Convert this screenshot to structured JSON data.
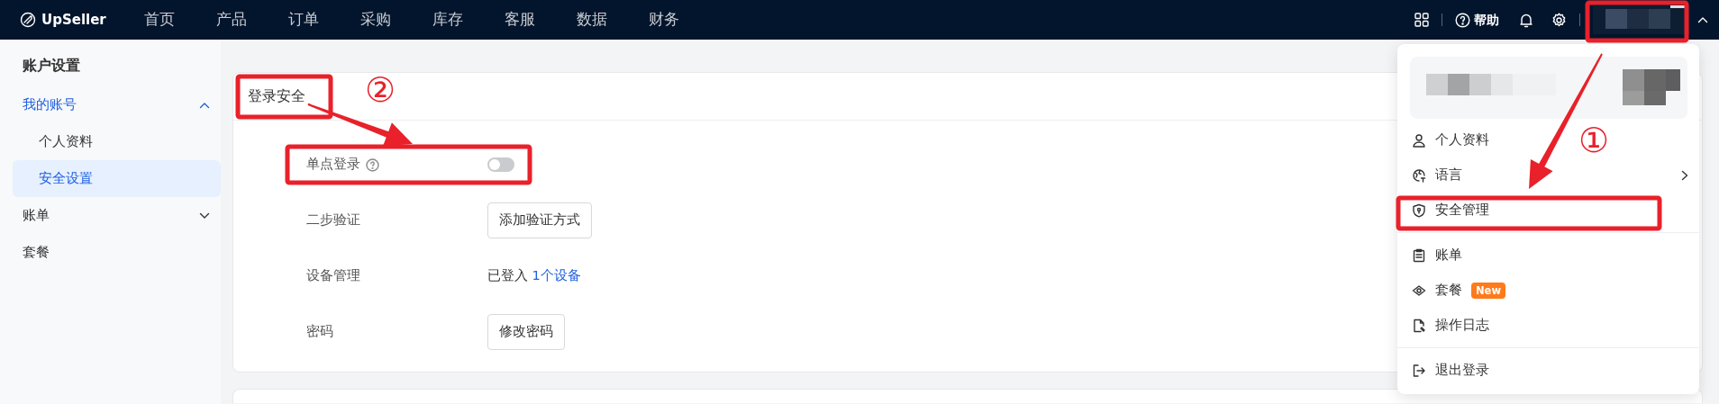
{
  "navbar": {
    "brand": "UpSeller",
    "menu": [
      "首页",
      "产品",
      "订单",
      "采购",
      "库存",
      "客服",
      "数据",
      "财务"
    ],
    "help": "帮助",
    "user_menu_open": true
  },
  "sidebar": {
    "title": "账户设置",
    "items": [
      {
        "label": "我的账号",
        "selected": true,
        "expanded": true,
        "children": [
          {
            "label": "个人资料",
            "selected": false
          },
          {
            "label": "安全设置",
            "selected": true
          }
        ]
      },
      {
        "label": "账单",
        "selected": false,
        "expanded": false
      },
      {
        "label": "套餐",
        "selected": false
      }
    ]
  },
  "login_security": {
    "title": "登录安全",
    "rows": [
      {
        "kind": "toggle",
        "label": "单点登录",
        "help": true,
        "on": false
      },
      {
        "kind": "button",
        "label": "二步验证",
        "button": "添加验证方式"
      },
      {
        "kind": "link",
        "label": "设备管理",
        "text": "已登入",
        "link": "1个设备"
      },
      {
        "kind": "button",
        "label": "密码",
        "button": "修改密码"
      }
    ]
  },
  "user_menu": {
    "groups": [
      [
        {
          "label": "个人资料",
          "submenu": false
        },
        {
          "label": "语言",
          "submenu": true
        },
        {
          "label": "安全管理",
          "submenu": false
        }
      ],
      [
        {
          "label": "账单",
          "submenu": false
        },
        {
          "label": "套餐",
          "submenu": false,
          "badge": "New"
        },
        {
          "label": "操作日志",
          "submenu": false
        }
      ],
      [
        {
          "label": "退出登录",
          "submenu": false
        }
      ]
    ]
  },
  "annotations": [
    {
      "number": "①"
    },
    {
      "number": "②"
    }
  ]
}
